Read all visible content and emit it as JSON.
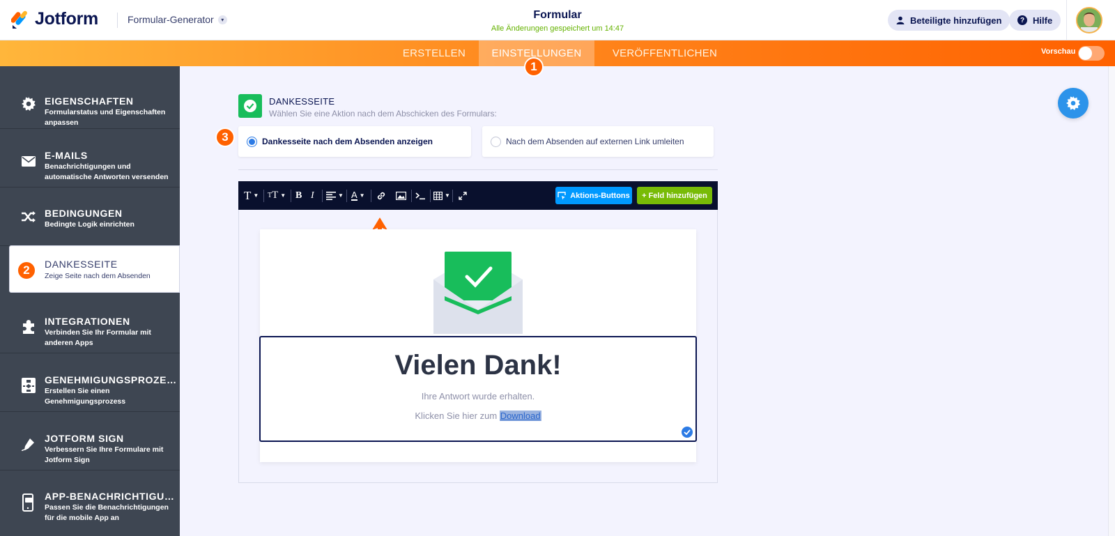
{
  "header": {
    "logo_text": "Jotform",
    "builder_label": "Formular-Generator",
    "form_title": "Formular",
    "save_status": "Alle Änderungen gespeichert um 14:47",
    "share_label": "Beteiligte hinzufügen",
    "help_label": "Hilfe"
  },
  "tabs": [
    {
      "label": "ERSTELLEN"
    },
    {
      "label": "EINSTELLUNGEN"
    },
    {
      "label": "VERÖFFENTLICHEN"
    }
  ],
  "preview_label": "Vorschau",
  "badges": [
    "1",
    "2",
    "3"
  ],
  "sidebar": {
    "items": [
      {
        "title": "EIGENSCHAFTEN",
        "desc": "Formularstatus und Eigenschaften anpassen",
        "icon": "gear-icon"
      },
      {
        "title": "E-MAILS",
        "desc": "Benachrichtigungen und automatische Antworten versenden",
        "icon": "envelope-icon"
      },
      {
        "title": "BEDINGUNGEN",
        "desc": "Bedingte Logik einrichten",
        "icon": "shuffle-icon"
      },
      {
        "title": "DANKESSEITE",
        "desc": "Zeige Seite nach dem Absenden",
        "icon": "thank-you-icon"
      },
      {
        "title": "INTEGRATIONEN",
        "desc": "Verbinden Sie Ihr Formular mit anderen Apps",
        "icon": "puzzle-icon"
      },
      {
        "title": "GENEHMIGUNGSPROZESS",
        "desc": "Erstellen Sie einen Genehmigungsprozess",
        "icon": "flow-icon"
      },
      {
        "title": "JOTFORM SIGN",
        "desc": "Verbessern Sie Ihre Formulare mit Jotform Sign",
        "icon": "pen-icon"
      },
      {
        "title": "APP-BENACHRICHTIGUNG",
        "desc": "Passen Sie die Benachrichtigungen für die mobile App an",
        "icon": "phone-icon"
      }
    ]
  },
  "section": {
    "title": "DANKESSEITE",
    "subtitle": "Wählen Sie eine Aktion nach dem Abschicken des Formulars:"
  },
  "options": {
    "show_page": "Dankesseite nach dem Absenden anzeigen",
    "redirect": "Nach dem Absenden auf externen Link umleiten"
  },
  "toolbar": {
    "action_buttons_label": "Aktions-Buttons",
    "add_field_label": "+ Feld hinzufügen"
  },
  "thanks": {
    "heading": "Vielen Dank!",
    "subtext": "Ihre Antwort wurde erhalten.",
    "download_prefix": "Klicken Sie hier zum ",
    "download_link": "Download"
  },
  "colors": {
    "brand_orange": "#ff6100",
    "sidebar_bg": "#3e4652",
    "success_green": "#18bd5b",
    "primary_blue": "#0099ff"
  }
}
